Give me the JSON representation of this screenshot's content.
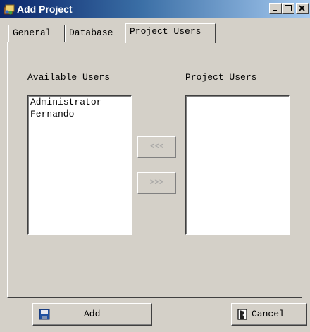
{
  "window": {
    "title": "Add Project",
    "icons": {
      "app": "app-project-icon",
      "minimize": "minimize-icon",
      "maximize": "maximize-icon",
      "close": "close-icon"
    }
  },
  "tabs": [
    {
      "label": "General",
      "active": false
    },
    {
      "label": "Database",
      "active": false
    },
    {
      "label": "Project Users",
      "active": true
    }
  ],
  "project_users_tab": {
    "available_label": "Available Users",
    "project_label": "Project Users",
    "available_users": [
      "Administrator",
      "Fernando"
    ],
    "project_users": [],
    "move_left_label": "<<<",
    "move_right_label": ">>>"
  },
  "footer": {
    "add_label": "Add",
    "add_icon": "save-disk-icon",
    "cancel_label": "Cancel",
    "cancel_icon": "exit-door-icon"
  },
  "colors": {
    "face": "#d4d0c8",
    "title_start": "#0a246a",
    "title_end": "#a6caf0",
    "disabled_text": "#a0a0a0"
  }
}
